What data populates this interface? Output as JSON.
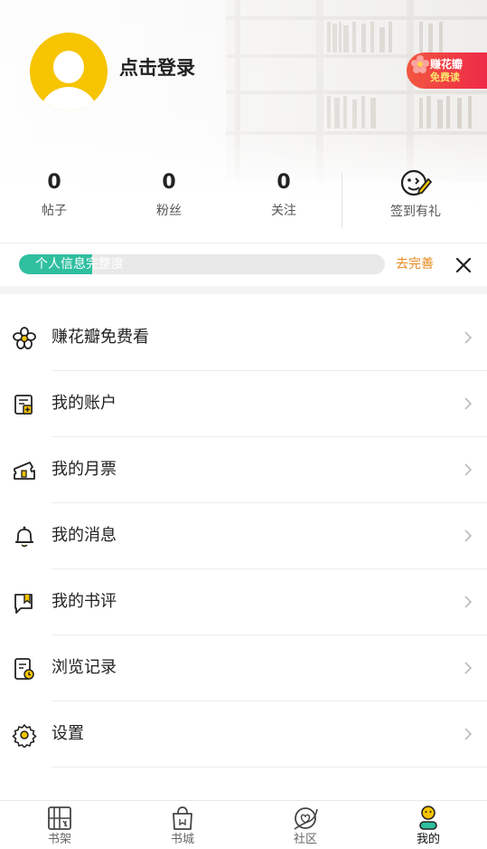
{
  "profile": {
    "login_label": "点击登录"
  },
  "earn_badge": {
    "line1": "赚花瓣",
    "line2": "免费读"
  },
  "stats": [
    {
      "count": "0",
      "label": "帖子"
    },
    {
      "count": "0",
      "label": "粉丝"
    },
    {
      "count": "0",
      "label": "关注"
    }
  ],
  "signin": {
    "label": "签到有礼"
  },
  "profile_completion": {
    "label": "个人信息完整度",
    "progress": 0.2,
    "action_label": "去完善"
  },
  "menu": [
    {
      "label": "赚花瓣免费看",
      "icon": "flower-icon"
    },
    {
      "label": "我的账户",
      "icon": "wallet-icon"
    },
    {
      "label": "我的月票",
      "icon": "ticket-icon"
    },
    {
      "label": "我的消息",
      "icon": "bell-icon"
    },
    {
      "label": "我的书评",
      "icon": "book-review-icon"
    },
    {
      "label": "浏览记录",
      "icon": "history-icon"
    },
    {
      "label": "设置",
      "icon": "gear-icon"
    }
  ],
  "tabbar": [
    {
      "label": "书架",
      "icon": "bookshelf-icon"
    },
    {
      "label": "书城",
      "icon": "bookstore-bag-icon"
    },
    {
      "label": "社区",
      "icon": "community-icon"
    },
    {
      "label": "我的",
      "icon": "mine-icon",
      "active": true
    }
  ],
  "colors": {
    "avatar": "#f6c400",
    "accent_green": "#2fbf9f",
    "accent_orange": "#e58a1e",
    "badge_red": "#ee2a48"
  }
}
